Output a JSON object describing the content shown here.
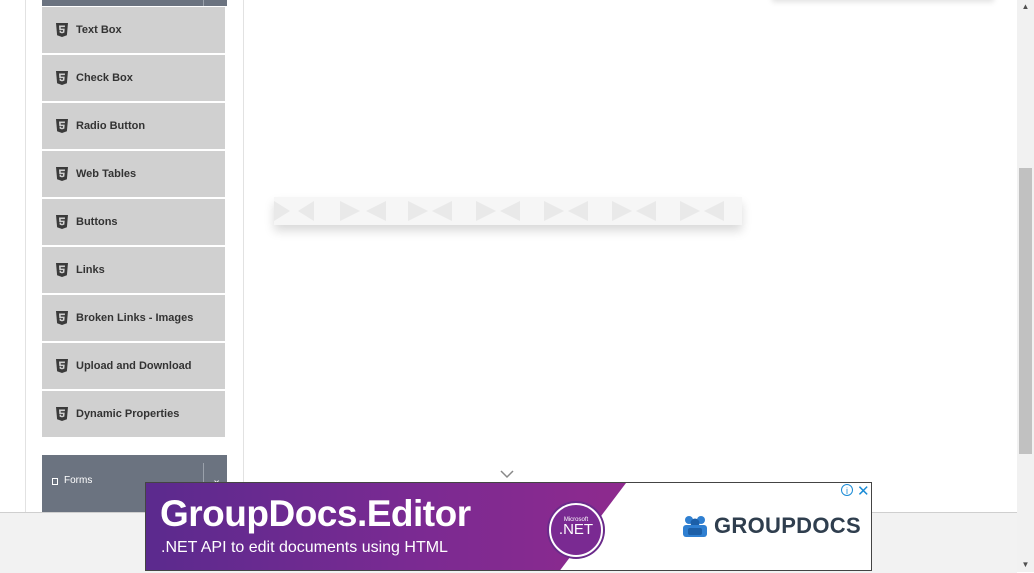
{
  "sidebar": {
    "items": [
      {
        "label": "Text Box",
        "icon": "html5-icon"
      },
      {
        "label": "Check Box",
        "icon": "html5-icon"
      },
      {
        "label": "Radio Button",
        "icon": "html5-icon"
      },
      {
        "label": "Web Tables",
        "icon": "html5-icon"
      },
      {
        "label": "Buttons",
        "icon": "html5-icon"
      },
      {
        "label": "Links",
        "icon": "html5-icon"
      },
      {
        "label": "Broken Links - Images",
        "icon": "html5-icon"
      },
      {
        "label": "Upload and Download",
        "icon": "html5-icon"
      },
      {
        "label": "Dynamic Properties",
        "icon": "html5-icon"
      }
    ],
    "forms_group": {
      "label": "Forms",
      "icon": "file-icon",
      "arrow_icon": "arrow-icon"
    },
    "header_color": "#6b7380",
    "item_color": "#d0d0d0"
  },
  "main": {
    "scroll_icon": "chevron-down-icon"
  },
  "ad": {
    "title": "GroupDocs.Editor",
    "subtitle": ".NET API to edit documents using HTML",
    "badge_small": "Microsoft",
    "badge_main": ".NET",
    "brand": "GROUPDOCS",
    "info_icon": "info-icon",
    "close_icon": "close-icon",
    "colors": {
      "purple": "#5b2a8e",
      "accent": "#1a8bd6",
      "brand_text": "#2f3e4e"
    }
  }
}
